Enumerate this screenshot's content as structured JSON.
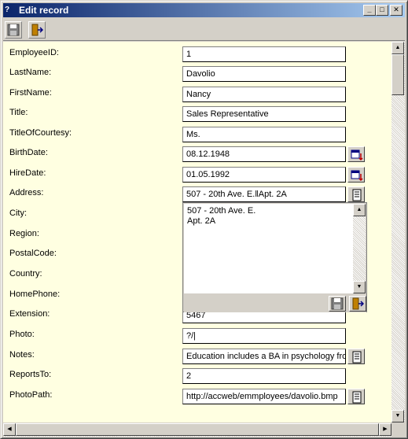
{
  "window": {
    "title": "Edit record"
  },
  "titlebar_buttons": {
    "minimize": "_",
    "maximize": "□",
    "close": "✕"
  },
  "toolbar": {
    "save_icon": "floppy-disk-icon",
    "exit_icon": "exit-door-icon"
  },
  "fields": [
    {
      "label": "EmployeeID:",
      "value": "1"
    },
    {
      "label": "LastName:",
      "value": "Davolio"
    },
    {
      "label": "FirstName:",
      "value": "Nancy"
    },
    {
      "label": "Title:",
      "value": "Sales Representative"
    },
    {
      "label": "TitleOfCourtesy:",
      "value": "Ms."
    },
    {
      "label": "BirthDate:",
      "value": "08.12.1948"
    },
    {
      "label": "HireDate:",
      "value": "01.05.1992"
    },
    {
      "label": "Address:",
      "value": "507 - 20th Ave. E.‖Apt. 2A"
    },
    {
      "label": "City:",
      "value": ""
    },
    {
      "label": "Region:",
      "value": ""
    },
    {
      "label": "PostalCode:",
      "value": ""
    },
    {
      "label": "Country:",
      "value": ""
    },
    {
      "label": "HomePhone:",
      "value": ""
    },
    {
      "label": "Extension:",
      "value": "5467"
    },
    {
      "label": "Photo:",
      "value": "?/|"
    },
    {
      "label": "Notes:",
      "value": "Education includes a BA in psychology fro"
    },
    {
      "label": "ReportsTo:",
      "value": "2"
    },
    {
      "label": "PhotoPath:",
      "value": "http://accweb/emmployees/davolio.bmp"
    }
  ],
  "memo_popup": {
    "text": "507 - 20th Ave. E.\nApt. 2A"
  },
  "colors": {
    "form_bg": "#ffffe1",
    "title_start": "#0a246a",
    "title_end": "#a6caf0"
  }
}
